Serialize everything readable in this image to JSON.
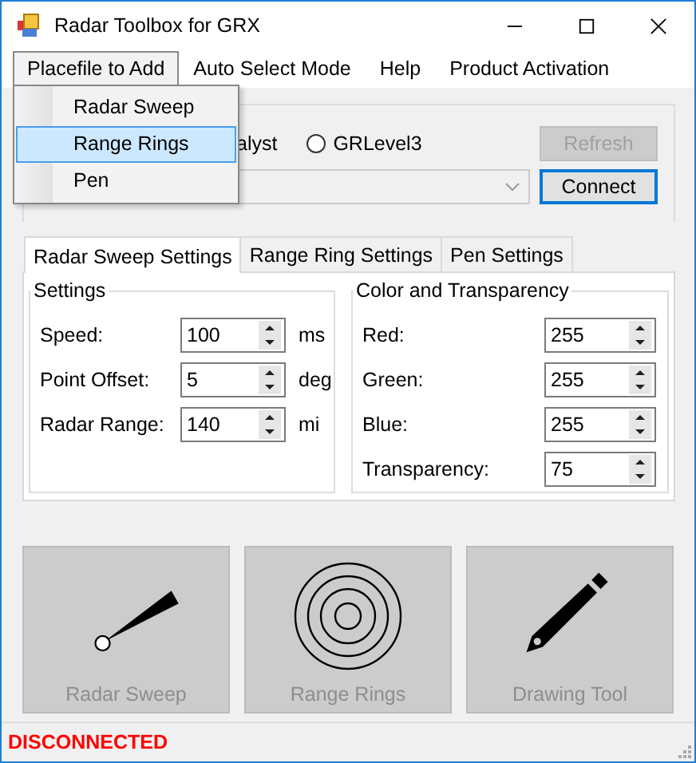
{
  "window": {
    "title": "Radar Toolbox for GRX"
  },
  "menu": [
    {
      "label": "Placefile to Add",
      "selected": true
    },
    {
      "label": "Auto Select Mode",
      "selected": false
    },
    {
      "label": "Help",
      "selected": false
    },
    {
      "label": "Product Activation",
      "selected": false
    }
  ],
  "dropdown": [
    {
      "label": "Radar Sweep",
      "selected": false
    },
    {
      "label": "Range Rings",
      "selected": true
    },
    {
      "label": "Pen",
      "selected": false
    }
  ],
  "connection": {
    "partial_radio_label": "alyst",
    "radio": {
      "label": "GRLevel3",
      "checked": false
    },
    "refresh": {
      "label": "Refresh",
      "disabled": true
    },
    "connect": {
      "label": "Connect",
      "disabled": false
    }
  },
  "tabs": [
    {
      "label": "Radar Sweep Settings",
      "selected": true
    },
    {
      "label": "Range Ring Settings",
      "selected": false
    },
    {
      "label": "Pen Settings",
      "selected": false
    }
  ],
  "settings": {
    "title": "Settings",
    "fields": [
      {
        "label": "Speed:",
        "value": "100",
        "unit": "ms"
      },
      {
        "label": "Point Offset:",
        "value": "5",
        "unit": "deg"
      },
      {
        "label": "Radar Range:",
        "value": "140",
        "unit": "mi"
      }
    ]
  },
  "color": {
    "title": "Color and Transparency",
    "fields": [
      {
        "label": "Red:",
        "value": "255"
      },
      {
        "label": "Green:",
        "value": "255"
      },
      {
        "label": "Blue:",
        "value": "255"
      },
      {
        "label": "Transparency:",
        "value": "75"
      }
    ]
  },
  "tools": [
    {
      "kind": "sweep",
      "label": "Radar Sweep",
      "disabled": true
    },
    {
      "kind": "rings",
      "label": "Range Rings",
      "disabled": true
    },
    {
      "kind": "pen",
      "label": "Drawing Tool",
      "disabled": true
    }
  ],
  "status_bar": {
    "text": "DISCONNECTED"
  }
}
